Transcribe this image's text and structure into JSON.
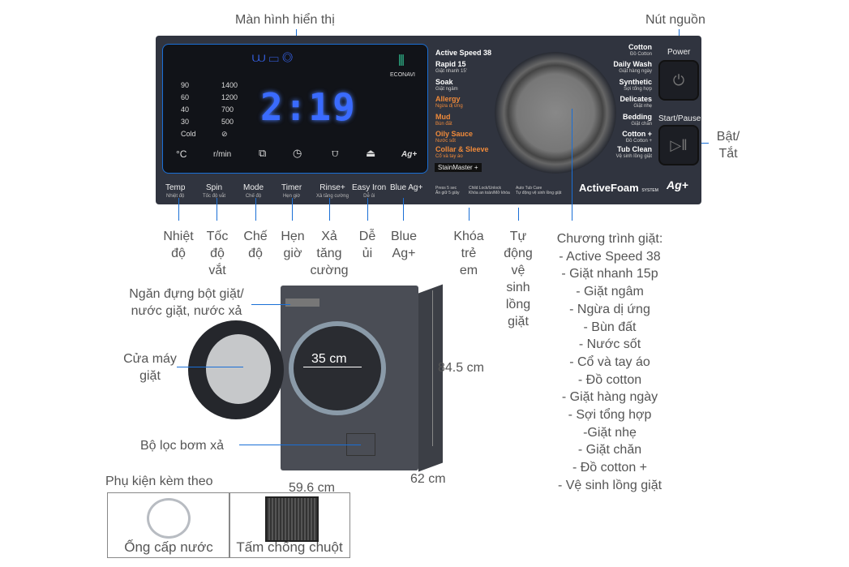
{
  "callouts": {
    "display": "Màn hình hiển thị",
    "power": "Nút nguồn",
    "start": "Bật/ Tắt",
    "temp": "Nhiệt độ",
    "spin": "Tốc độ vắt",
    "mode": "Chế độ",
    "timer": "Hẹn giờ",
    "rinse": "Xả tăng cường",
    "iron": "Dễ ủi",
    "ag": "Blue Ag+",
    "lock": "Khóa trẻ em",
    "tub": "Tự động vệ sinh lồng giặt",
    "programs_title": "Chương trình giặt:",
    "programs": [
      "- Active Speed 38",
      "- Giặt nhanh 15p",
      "- Giặt ngâm",
      "- Ngừa dị ứng",
      "- Bùn đất",
      "- Nước sốt",
      "- Cổ và tay áo",
      "- Đồ cotton",
      "- Giặt hàng ngày",
      "- Sợi tổng hợp",
      "-Giặt nhẹ",
      "- Giặt chăn",
      "- Đồ cotton +",
      "- Vệ sinh lồng giặt"
    ],
    "dispenser": "Ngăn đựng bột giặt/ nước giặt, nước xả",
    "door": "Cửa máy giặt",
    "filter": "Bộ lọc bơm xả",
    "door_size": "35 cm",
    "height": "84.5 cm",
    "depth": "62 cm",
    "width": "59.6 cm",
    "accessories_title": "Phụ kiện kèm theo",
    "accessories": [
      "Ống cấp nước",
      "Tấm chống chuột"
    ]
  },
  "panel": {
    "temps": [
      "90",
      "60",
      "40",
      "30",
      "Cold"
    ],
    "spins": [
      "1400",
      "1200",
      "700",
      "500"
    ],
    "time": "2:19",
    "econavi": "ECONAVI",
    "temp_unit": "°C",
    "spin_unit": "r/min",
    "ag_icon": "Ag+",
    "buttons": [
      {
        "en": "Temp",
        "vi": "Nhiệt độ"
      },
      {
        "en": "Spin",
        "vi": "Tốc độ vắt"
      },
      {
        "en": "Mode",
        "vi": "Chế độ"
      },
      {
        "en": "Timer",
        "vi": "Hẹn giờ"
      },
      {
        "en": "Rinse+",
        "vi": "Xả tăng cường"
      },
      {
        "en": "Easy Iron",
        "vi": "Dễ ủi"
      },
      {
        "en": "Blue Ag+",
        "vi": ""
      }
    ],
    "left_programs": [
      {
        "en": "Active Speed 38",
        "vi": ""
      },
      {
        "en": "Rapid 15",
        "vi": "Giặt nhanh 15'"
      },
      {
        "en": "Soak",
        "vi": "Giặt ngâm"
      },
      {
        "en": "Allergy",
        "vi": "Ngừa dị ứng"
      },
      {
        "en": "Mud",
        "vi": "Bùn đất"
      },
      {
        "en": "Oily Sauce",
        "vi": "Nước sốt"
      },
      {
        "en": "Collar & Sleeve",
        "vi": "Cổ và tay áo"
      }
    ],
    "right_programs": [
      {
        "en": "Cotton",
        "vi": "Đồ Cotton"
      },
      {
        "en": "Daily Wash",
        "vi": "Giặt hàng ngày"
      },
      {
        "en": "Synthetic",
        "vi": "Sợi tổng hợp"
      },
      {
        "en": "Delicates",
        "vi": "Giặt nhẹ"
      },
      {
        "en": "Bedding",
        "vi": "Giặt chăn"
      },
      {
        "en": "Cotton +",
        "vi": "Đồ Cotton +"
      },
      {
        "en": "Tub Clean",
        "vi": "Vệ sinh lồng giặt"
      }
    ],
    "stainmaster": "StainMaster +",
    "press": "Press 5 sec",
    "press_vi": "Ấn giữ 5 giây",
    "child_lock": "Child Lock/Unlock",
    "child_lock_vi": "Khóa an toàn/Mở khóa",
    "auto_tub": "Auto Tub Care",
    "auto_tub_vi": "Tự động vệ sinh lồng giặt",
    "brand": "ActiveFoam",
    "brand_sub": "SYSTEM",
    "blue_ag": "Ag+",
    "power_label": "Power",
    "start_label": "Start/Pause"
  },
  "colors": {
    "panel": "#30343f",
    "accent": "#1a6fd6",
    "orange": "#f08a3a",
    "digits": "#3a6bff"
  }
}
